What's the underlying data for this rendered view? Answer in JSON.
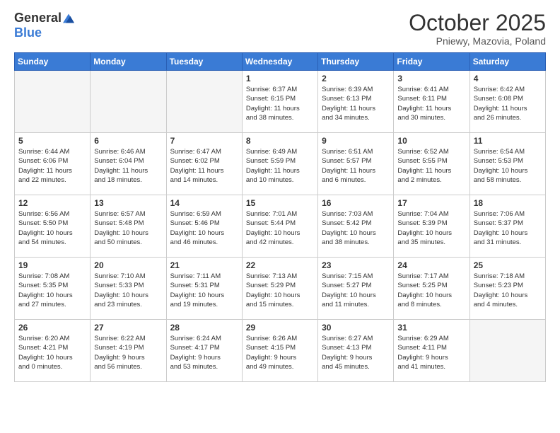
{
  "logo": {
    "general": "General",
    "blue": "Blue"
  },
  "header": {
    "month": "October 2025",
    "location": "Pniewy, Mazovia, Poland"
  },
  "days_of_week": [
    "Sunday",
    "Monday",
    "Tuesday",
    "Wednesday",
    "Thursday",
    "Friday",
    "Saturday"
  ],
  "weeks": [
    [
      {
        "day": "",
        "info": ""
      },
      {
        "day": "",
        "info": ""
      },
      {
        "day": "",
        "info": ""
      },
      {
        "day": "1",
        "info": "Sunrise: 6:37 AM\nSunset: 6:15 PM\nDaylight: 11 hours\nand 38 minutes."
      },
      {
        "day": "2",
        "info": "Sunrise: 6:39 AM\nSunset: 6:13 PM\nDaylight: 11 hours\nand 34 minutes."
      },
      {
        "day": "3",
        "info": "Sunrise: 6:41 AM\nSunset: 6:11 PM\nDaylight: 11 hours\nand 30 minutes."
      },
      {
        "day": "4",
        "info": "Sunrise: 6:42 AM\nSunset: 6:08 PM\nDaylight: 11 hours\nand 26 minutes."
      }
    ],
    [
      {
        "day": "5",
        "info": "Sunrise: 6:44 AM\nSunset: 6:06 PM\nDaylight: 11 hours\nand 22 minutes."
      },
      {
        "day": "6",
        "info": "Sunrise: 6:46 AM\nSunset: 6:04 PM\nDaylight: 11 hours\nand 18 minutes."
      },
      {
        "day": "7",
        "info": "Sunrise: 6:47 AM\nSunset: 6:02 PM\nDaylight: 11 hours\nand 14 minutes."
      },
      {
        "day": "8",
        "info": "Sunrise: 6:49 AM\nSunset: 5:59 PM\nDaylight: 11 hours\nand 10 minutes."
      },
      {
        "day": "9",
        "info": "Sunrise: 6:51 AM\nSunset: 5:57 PM\nDaylight: 11 hours\nand 6 minutes."
      },
      {
        "day": "10",
        "info": "Sunrise: 6:52 AM\nSunset: 5:55 PM\nDaylight: 11 hours\nand 2 minutes."
      },
      {
        "day": "11",
        "info": "Sunrise: 6:54 AM\nSunset: 5:53 PM\nDaylight: 10 hours\nand 58 minutes."
      }
    ],
    [
      {
        "day": "12",
        "info": "Sunrise: 6:56 AM\nSunset: 5:50 PM\nDaylight: 10 hours\nand 54 minutes."
      },
      {
        "day": "13",
        "info": "Sunrise: 6:57 AM\nSunset: 5:48 PM\nDaylight: 10 hours\nand 50 minutes."
      },
      {
        "day": "14",
        "info": "Sunrise: 6:59 AM\nSunset: 5:46 PM\nDaylight: 10 hours\nand 46 minutes."
      },
      {
        "day": "15",
        "info": "Sunrise: 7:01 AM\nSunset: 5:44 PM\nDaylight: 10 hours\nand 42 minutes."
      },
      {
        "day": "16",
        "info": "Sunrise: 7:03 AM\nSunset: 5:42 PM\nDaylight: 10 hours\nand 38 minutes."
      },
      {
        "day": "17",
        "info": "Sunrise: 7:04 AM\nSunset: 5:39 PM\nDaylight: 10 hours\nand 35 minutes."
      },
      {
        "day": "18",
        "info": "Sunrise: 7:06 AM\nSunset: 5:37 PM\nDaylight: 10 hours\nand 31 minutes."
      }
    ],
    [
      {
        "day": "19",
        "info": "Sunrise: 7:08 AM\nSunset: 5:35 PM\nDaylight: 10 hours\nand 27 minutes."
      },
      {
        "day": "20",
        "info": "Sunrise: 7:10 AM\nSunset: 5:33 PM\nDaylight: 10 hours\nand 23 minutes."
      },
      {
        "day": "21",
        "info": "Sunrise: 7:11 AM\nSunset: 5:31 PM\nDaylight: 10 hours\nand 19 minutes."
      },
      {
        "day": "22",
        "info": "Sunrise: 7:13 AM\nSunset: 5:29 PM\nDaylight: 10 hours\nand 15 minutes."
      },
      {
        "day": "23",
        "info": "Sunrise: 7:15 AM\nSunset: 5:27 PM\nDaylight: 10 hours\nand 11 minutes."
      },
      {
        "day": "24",
        "info": "Sunrise: 7:17 AM\nSunset: 5:25 PM\nDaylight: 10 hours\nand 8 minutes."
      },
      {
        "day": "25",
        "info": "Sunrise: 7:18 AM\nSunset: 5:23 PM\nDaylight: 10 hours\nand 4 minutes."
      }
    ],
    [
      {
        "day": "26",
        "info": "Sunrise: 6:20 AM\nSunset: 4:21 PM\nDaylight: 10 hours\nand 0 minutes."
      },
      {
        "day": "27",
        "info": "Sunrise: 6:22 AM\nSunset: 4:19 PM\nDaylight: 9 hours\nand 56 minutes."
      },
      {
        "day": "28",
        "info": "Sunrise: 6:24 AM\nSunset: 4:17 PM\nDaylight: 9 hours\nand 53 minutes."
      },
      {
        "day": "29",
        "info": "Sunrise: 6:26 AM\nSunset: 4:15 PM\nDaylight: 9 hours\nand 49 minutes."
      },
      {
        "day": "30",
        "info": "Sunrise: 6:27 AM\nSunset: 4:13 PM\nDaylight: 9 hours\nand 45 minutes."
      },
      {
        "day": "31",
        "info": "Sunrise: 6:29 AM\nSunset: 4:11 PM\nDaylight: 9 hours\nand 41 minutes."
      },
      {
        "day": "",
        "info": ""
      }
    ]
  ]
}
